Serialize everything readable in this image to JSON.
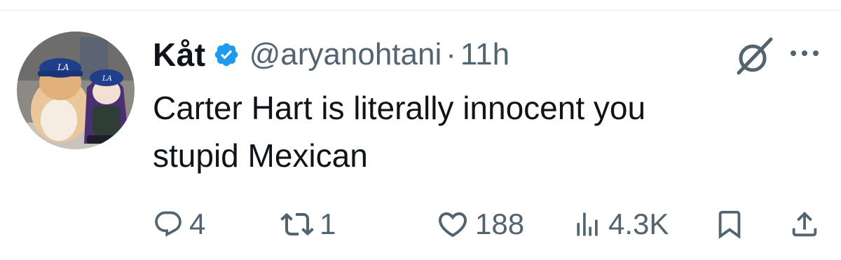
{
  "author": {
    "display_name": "Kåt",
    "handle": "@aryanohtani",
    "separator": "·",
    "time": "11h",
    "verified": true
  },
  "tweet": {
    "line1": "Carter Hart is literally innocent you",
    "line2": "stupid Mexican"
  },
  "actions": {
    "replies": "4",
    "reposts": "1",
    "likes": "188",
    "views": "4.3K"
  },
  "icons": {
    "verified": "verified-badge-icon",
    "grok": "grok-icon",
    "more": "more-icon",
    "reply": "reply-icon",
    "repost": "repost-icon",
    "like": "heart-icon",
    "views": "views-icon",
    "bookmark": "bookmark-icon",
    "share": "share-icon"
  },
  "colors": {
    "verified_blue": "#1d9bf0",
    "muted_text": "#536471",
    "primary_text": "#0f1419"
  }
}
